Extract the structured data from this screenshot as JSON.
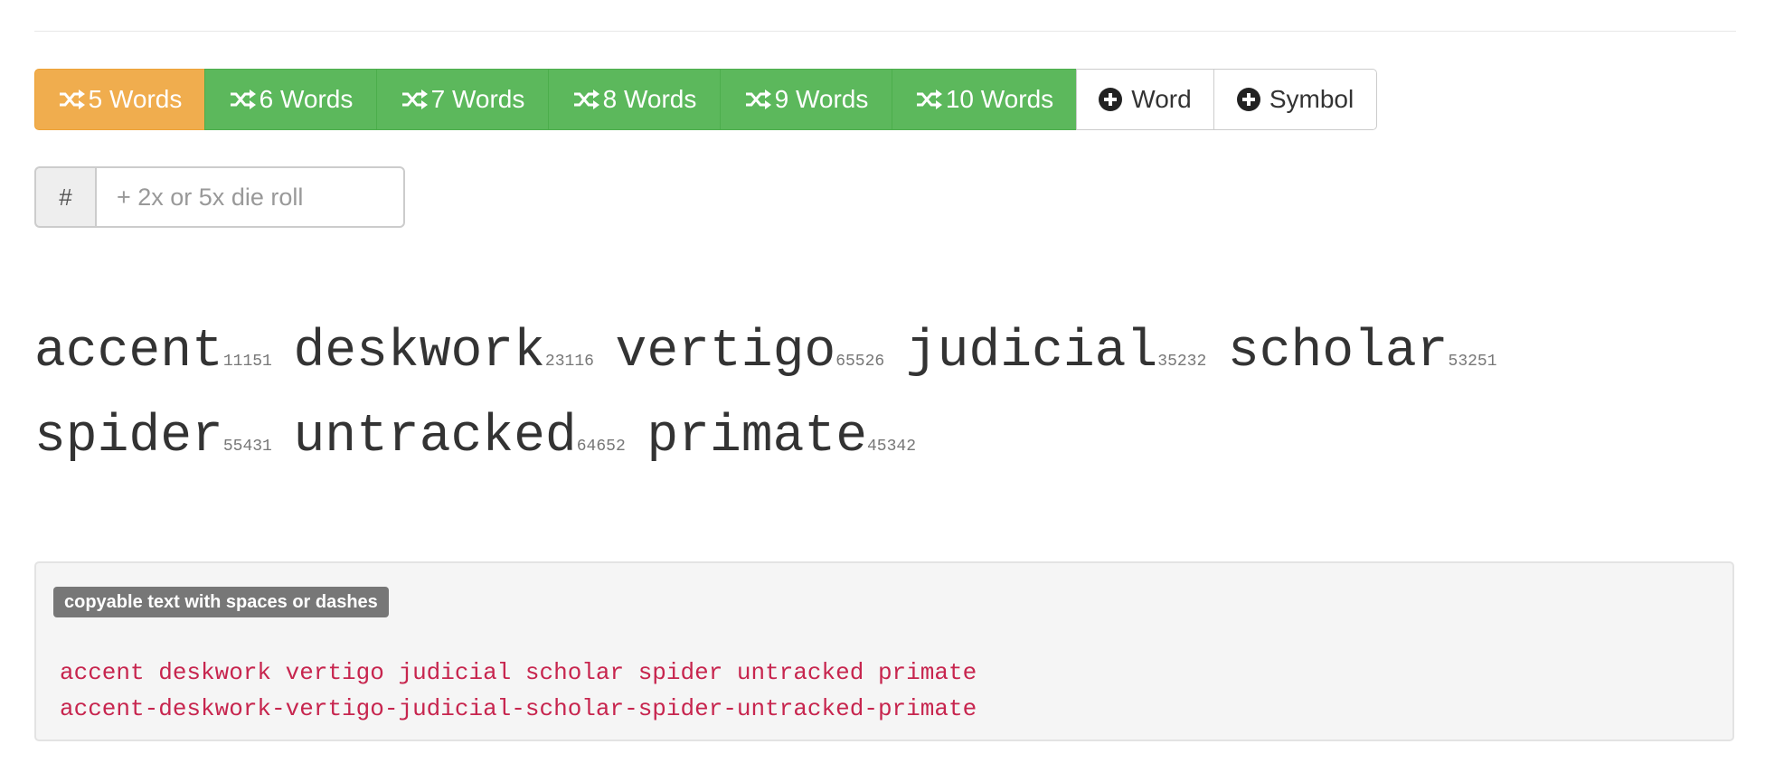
{
  "toolbar": {
    "generate_buttons": [
      {
        "label": "5 Words",
        "icon": "shuffle-icon",
        "active": true,
        "color": "#f0ad4e"
      },
      {
        "label": "6 Words",
        "icon": "shuffle-icon",
        "active": false,
        "color": "#5cb85c"
      },
      {
        "label": "7 Words",
        "icon": "shuffle-icon",
        "active": false,
        "color": "#5cb85c"
      },
      {
        "label": "8 Words",
        "icon": "shuffle-icon",
        "active": false,
        "color": "#5cb85c"
      },
      {
        "label": "9 Words",
        "icon": "shuffle-icon",
        "active": false,
        "color": "#5cb85c"
      },
      {
        "label": "10 Words",
        "icon": "shuffle-icon",
        "active": false,
        "color": "#5cb85c"
      }
    ],
    "add_word_label": "Word",
    "add_symbol_label": "Symbol",
    "add_icon": "plus-circle-icon"
  },
  "dice_input": {
    "addon": "#",
    "value": "",
    "placeholder": "+ 2x or 5x die roll"
  },
  "passphrase_words": [
    {
      "word": "accent",
      "roll": "11151"
    },
    {
      "word": "deskwork",
      "roll": "23116"
    },
    {
      "word": "vertigo",
      "roll": "65526"
    },
    {
      "word": "judicial",
      "roll": "35232"
    },
    {
      "word": "scholar",
      "roll": "53251"
    },
    {
      "word": "spider",
      "roll": "55431"
    },
    {
      "word": "untracked",
      "roll": "64652"
    },
    {
      "word": "primate",
      "roll": "45342"
    }
  ],
  "copyable": {
    "label": "copyable text with spaces or dashes",
    "spaces": "accent deskwork vertigo judicial scholar spider untracked primate",
    "dashes": "accent-deskwork-vertigo-judicial-scholar-spider-untracked-primate"
  }
}
